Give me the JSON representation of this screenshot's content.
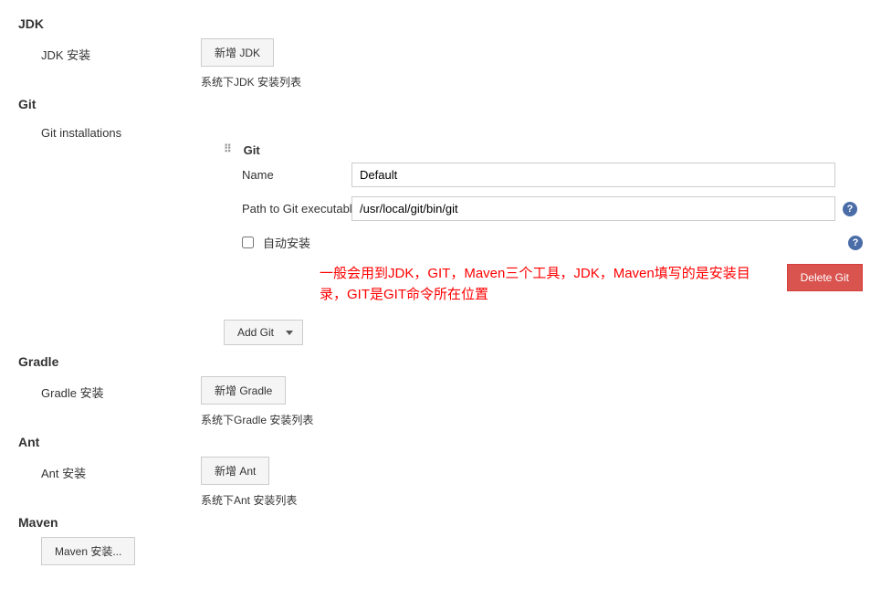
{
  "jdk": {
    "header": "JDK",
    "install_label": "JDK 安装",
    "add_button": "新增 JDK",
    "caption": "系统下JDK 安装列表"
  },
  "git": {
    "header": "Git",
    "installations_label": "Git installations",
    "box_title": "Git",
    "name_label": "Name",
    "name_value": "Default",
    "path_label": "Path to Git executable",
    "path_value": "/usr/local/git/bin/git",
    "auto_install_label": "自动安装",
    "annotation": "一般会用到JDK，GIT，Maven三个工具，JDK，Maven填写的是安装目录，GIT是GIT命令所在位置",
    "delete_button": "Delete Git",
    "add_button": "Add Git"
  },
  "gradle": {
    "header": "Gradle",
    "install_label": "Gradle 安装",
    "add_button": "新增 Gradle",
    "caption": "系统下Gradle 安装列表"
  },
  "ant": {
    "header": "Ant",
    "install_label": "Ant 安装",
    "add_button": "新增 Ant",
    "caption": "系统下Ant 安装列表"
  },
  "maven": {
    "header": "Maven",
    "install_button": "Maven 安装..."
  }
}
